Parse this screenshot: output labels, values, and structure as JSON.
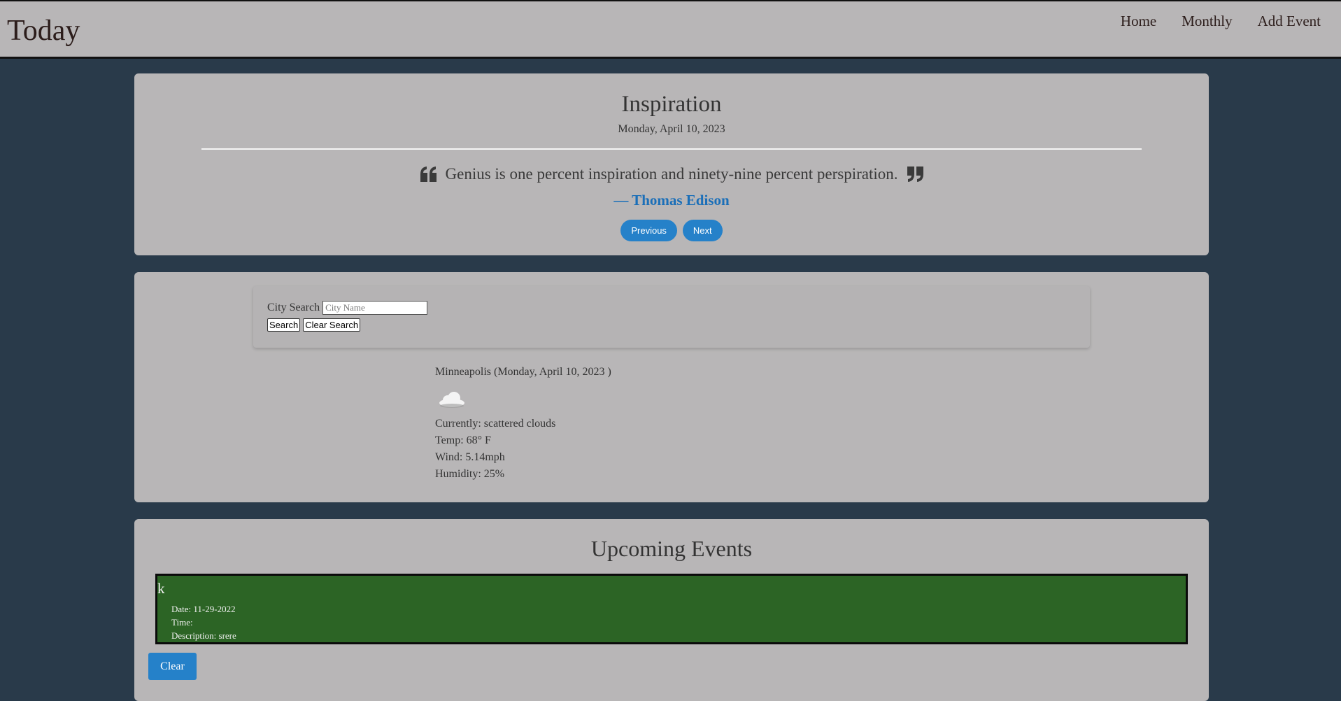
{
  "header": {
    "brand": "Today",
    "nav": [
      "Home",
      "Monthly",
      "Add Event"
    ]
  },
  "inspiration": {
    "title": "Inspiration",
    "date": "Monday, April 10, 2023",
    "quote": "Genius is one percent inspiration and ninety-nine percent perspiration.",
    "author": "— Thomas Edison",
    "previous_label": "Previous",
    "next_label": "Next",
    "accent_color": "#2581c9",
    "author_color": "#1b6fb8"
  },
  "weather": {
    "search_label": "City Search",
    "search_placeholder": "City Name",
    "search_button": "Search",
    "clear_search_button": "Clear Search",
    "city_line": "Minneapolis (Monday, April 10, 2023 )",
    "icon": "cloud-icon",
    "currently": "Currently: scattered clouds",
    "temp": "Temp: 68° F",
    "wind": "Wind: 5.14mph",
    "humidity": "Humidity: 25%"
  },
  "events": {
    "title": "Upcoming Events",
    "items": [
      {
        "name": "k",
        "date": "Date: 11-29-2022",
        "time": "Time:",
        "description": "Description: srere",
        "color": "#2c6425"
      }
    ],
    "clear_label": "Clear"
  },
  "colors": {
    "background": "#293a4a",
    "card": "#b8b6b7"
  }
}
